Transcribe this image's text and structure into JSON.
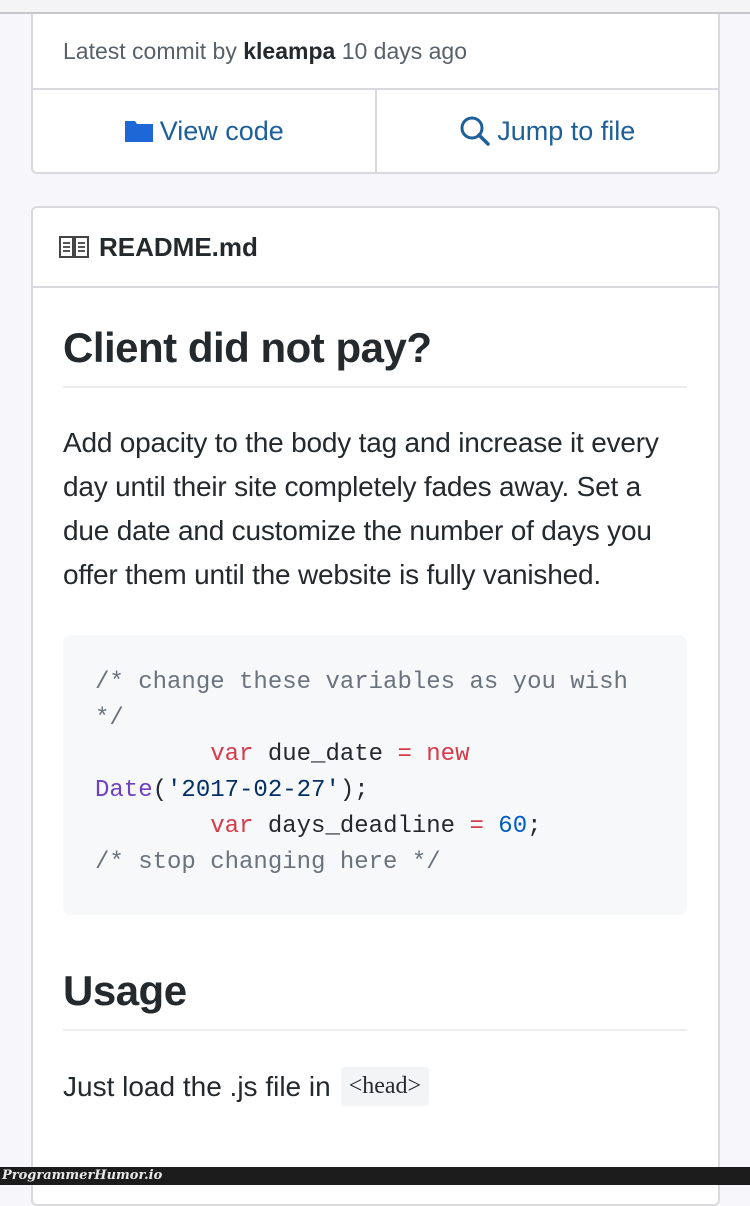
{
  "commit": {
    "prefix": "Latest commit by",
    "author": "kleampa",
    "time": "10 days ago"
  },
  "actions": {
    "view_code": {
      "label": "View code",
      "icon": "folder-icon",
      "color": "#1d67d6"
    },
    "jump_to_file": {
      "label": "Jump to file",
      "icon": "search-icon"
    }
  },
  "readme": {
    "filename": "README.md",
    "icon": "book-icon",
    "title": "Client did not pay?",
    "description": "Add opacity to the body tag and increase it every day until their site completely fades away. Set a due date and customize the number of days you offer them until the website is fully vanished.",
    "code": {
      "comment_start": "/* change these variables as you wish */",
      "line1_kw": "var",
      "line1_name": "due_date",
      "line1_op": "=",
      "line1_new": "new",
      "line1_fn": "Date",
      "line1_str": "'2017-02-27'",
      "line2_kw": "var",
      "line2_name": "days_deadline",
      "line2_op": "=",
      "line2_num": "60",
      "comment_end": "/* stop changing here */"
    },
    "usage_heading": "Usage",
    "usage_text": "Just load the .js file in",
    "usage_code": "<head>"
  },
  "watermark": "ProgrammerHumor.io"
}
